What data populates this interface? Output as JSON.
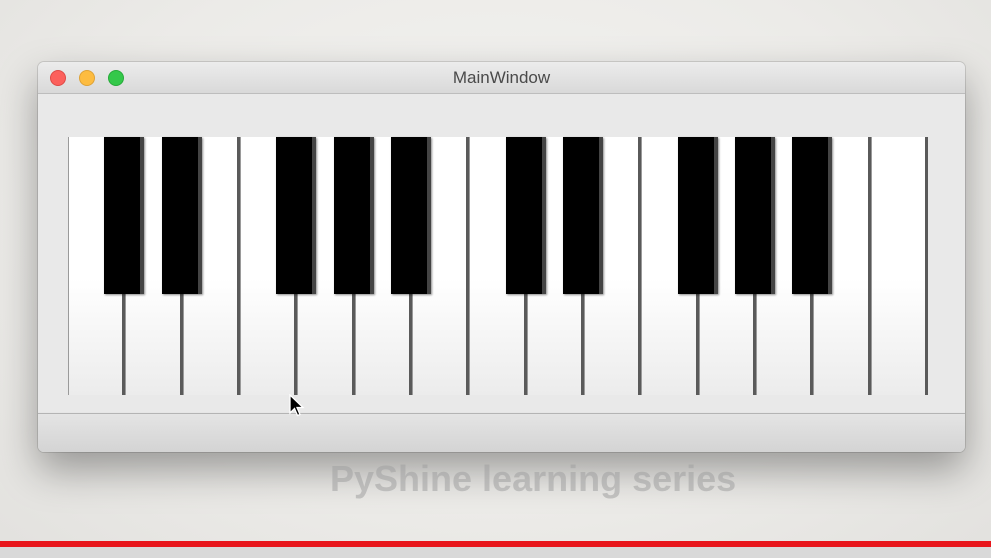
{
  "window": {
    "title": "MainWindow",
    "controls": {
      "close": "close-button",
      "minimize": "minimize-button",
      "maximize": "maximize-button"
    }
  },
  "piano": {
    "white_key_count": 15,
    "black_key_after_white": [
      0,
      1,
      3,
      4,
      5,
      7,
      8,
      10,
      11,
      12
    ],
    "colors": {
      "white_key": "#ffffff",
      "black_key": "#000000",
      "separator": "#5a5a5a"
    }
  },
  "overlay": {
    "watermark_text": "PyShine learning series"
  },
  "video_progress": {
    "fraction": 1.0,
    "color": "#e8151b"
  }
}
